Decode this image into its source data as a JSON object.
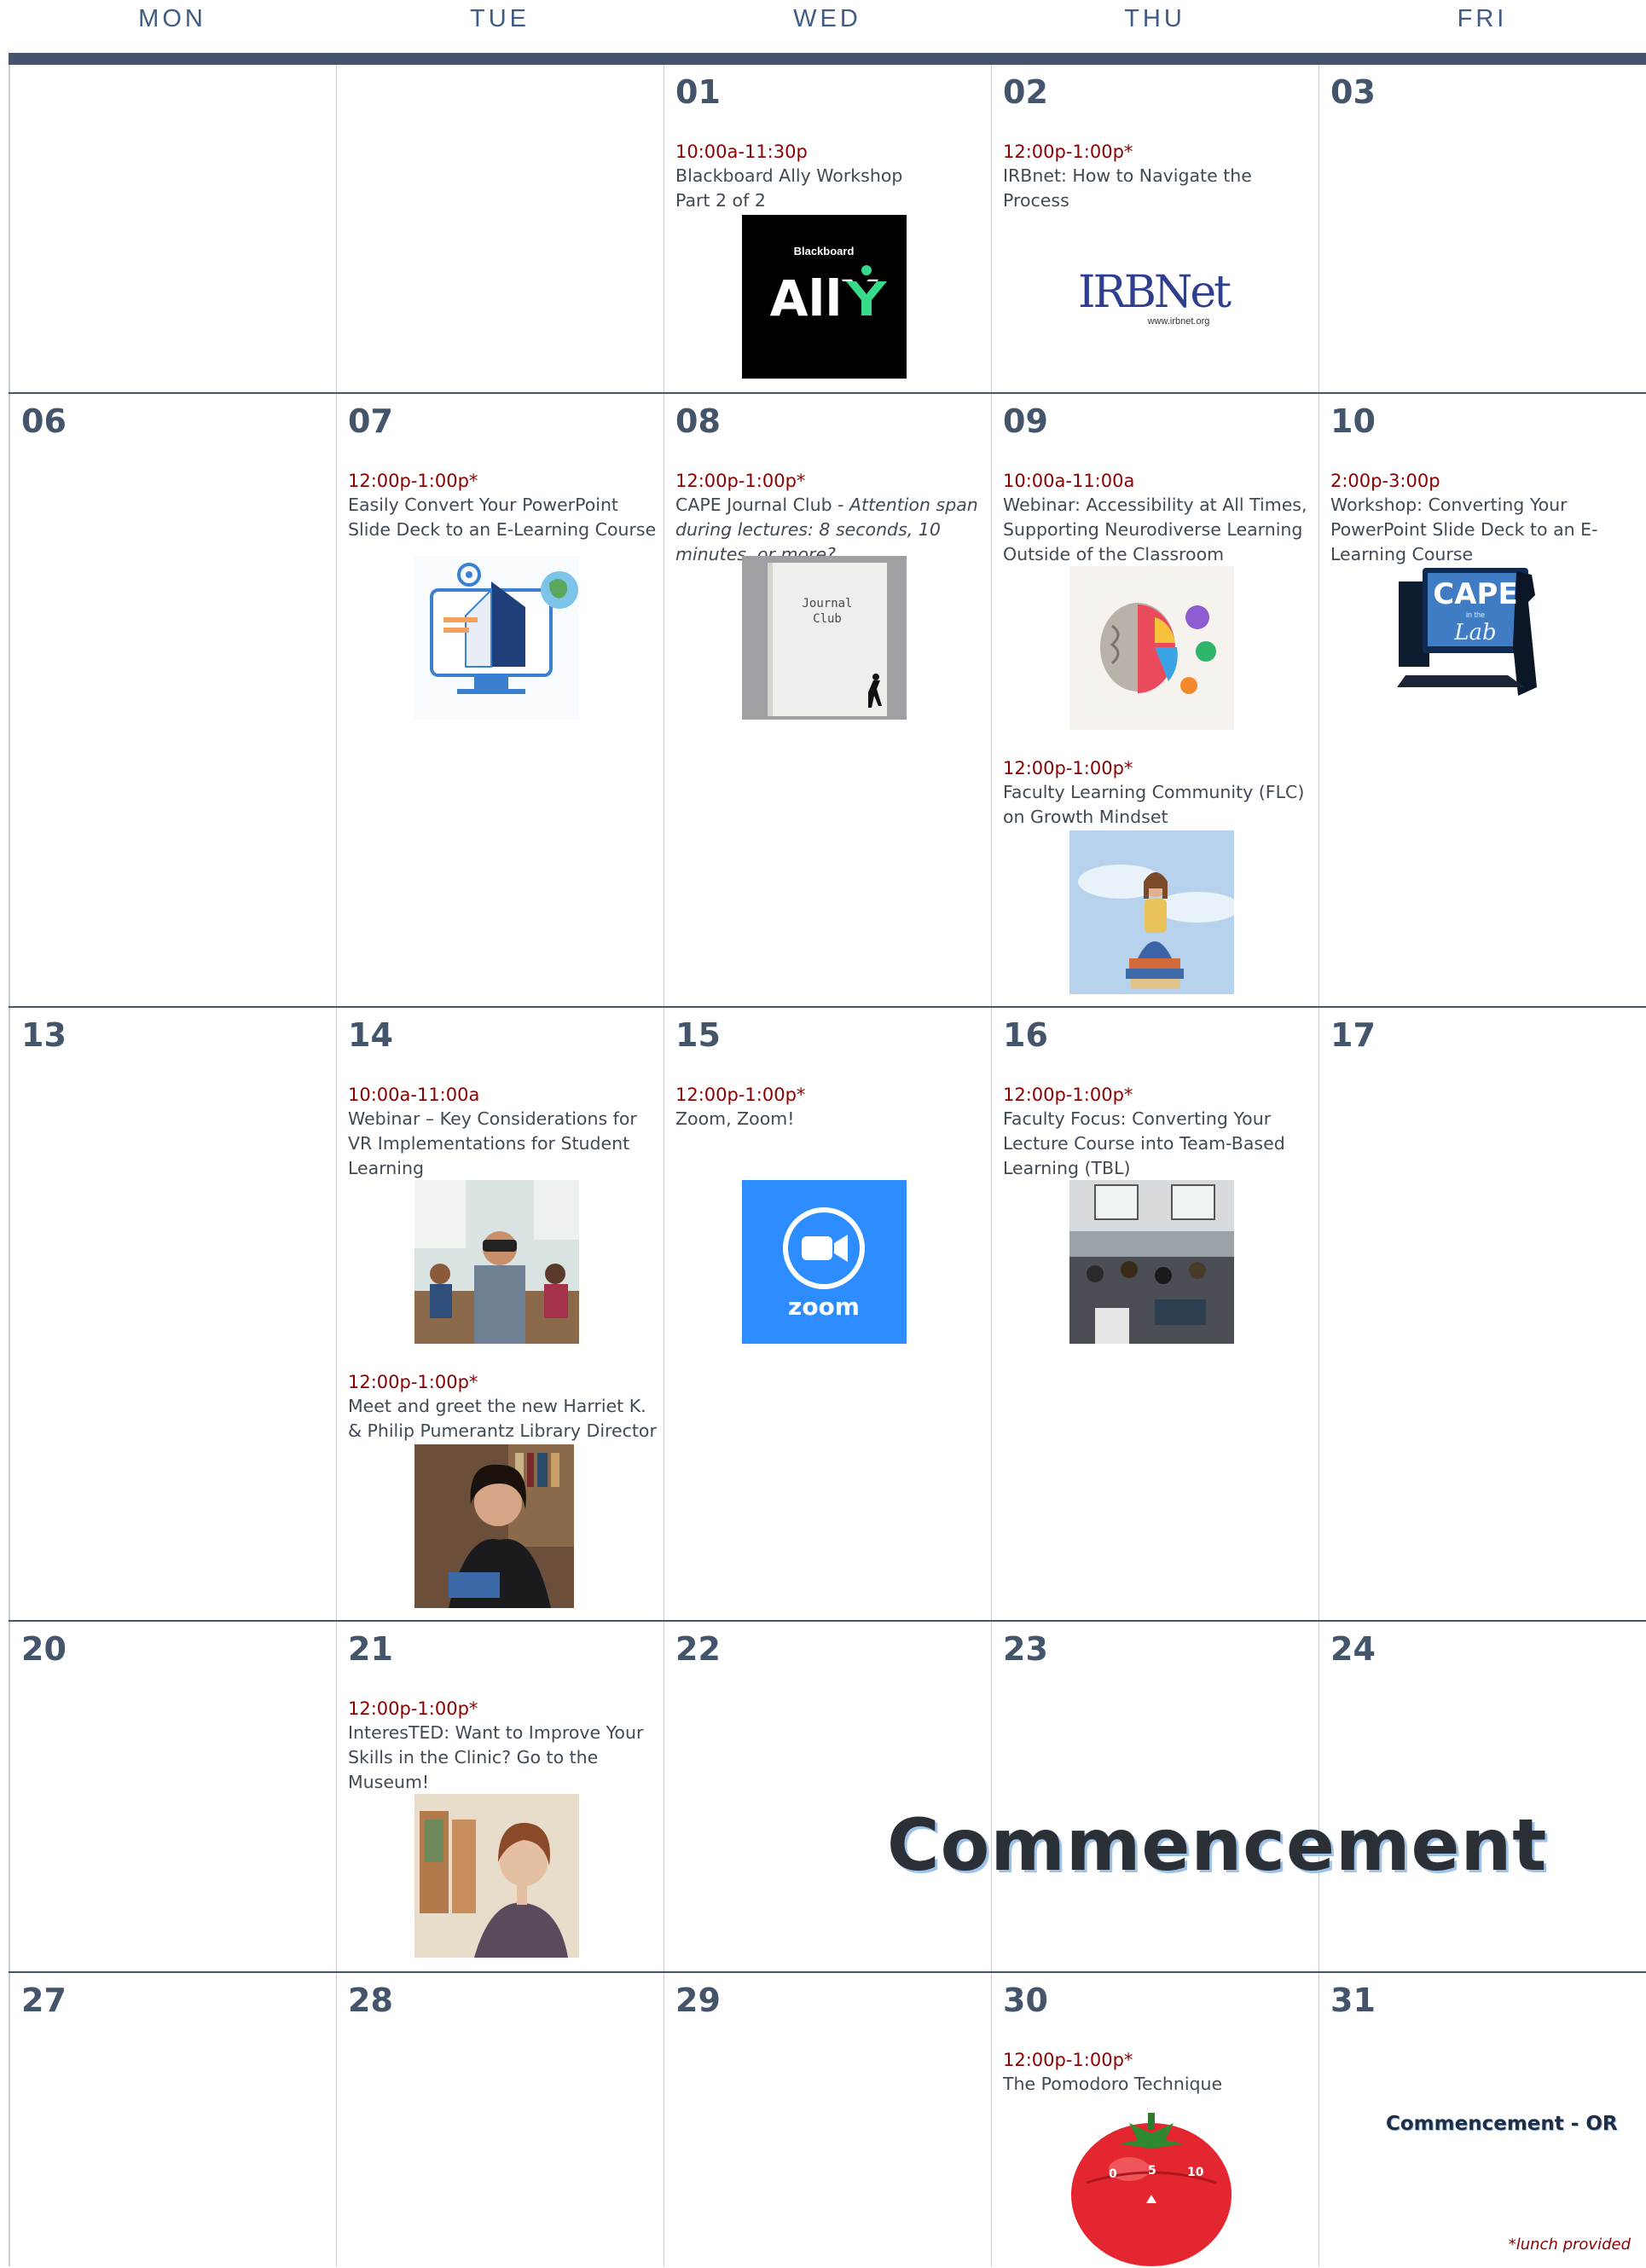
{
  "days": [
    "MON",
    "TUE",
    "WED",
    "THU",
    "FRI"
  ],
  "weeks": [
    {
      "dates": [
        "",
        "",
        "01",
        "02",
        "03"
      ]
    },
    {
      "dates": [
        "06",
        "07",
        "08",
        "09",
        "10"
      ]
    },
    {
      "dates": [
        "13",
        "14",
        "15",
        "16",
        "17"
      ]
    },
    {
      "dates": [
        "20",
        "21",
        "22",
        "23",
        "24"
      ]
    },
    {
      "dates": [
        "27",
        "28",
        "29",
        "30",
        "31"
      ]
    }
  ],
  "events": {
    "d01": {
      "time": "10:00a-11:30p",
      "title_line1": "Blackboard Ally Workshop",
      "title_line2": "Part 2 of 2"
    },
    "d02": {
      "time": "12:00p-1:00p*",
      "title_line1": "IRBnet: How to Navigate the",
      "title_line2": "Process"
    },
    "d07": {
      "time": "12:00p-1:00p*",
      "title_line1": "Easily Convert Your PowerPoint",
      "title_line2": "Slide Deck to an E-Learning Course"
    },
    "d08": {
      "time": "12:00p-1:00p*",
      "title_prefix": "CAPE Journal Club - ",
      "title_italic1": "Attention span",
      "title_italic2": "during lectures: 8 seconds, 10",
      "title_italic3": "minutes, or more?"
    },
    "d09a": {
      "time": "10:00a-11:00a",
      "title_line1": "Webinar: Accessibility at All Times,",
      "title_line2": "Supporting Neurodiverse Learning",
      "title_line3": "Outside of the Classroom"
    },
    "d09b": {
      "time": "12:00p-1:00p*",
      "title_line1": "Faculty Learning Community (FLC)",
      "title_line2": "on Growth Mindset"
    },
    "d10": {
      "time": "2:00p-3:00p",
      "title_line1": "Workshop: Converting Your",
      "title_line2": "PowerPoint Slide Deck to an E-",
      "title_line3": "Learning Course"
    },
    "d14a": {
      "time": "10:00a-11:00a",
      "title_line1": "Webinar – Key Considerations for",
      "title_line2": "VR Implementations for Student",
      "title_line3": "Learning"
    },
    "d14b": {
      "time": "12:00p-1:00p*",
      "title_line1": "Meet and greet the new Harriet K.",
      "title_line2": "& Philip Pumerantz Library Director"
    },
    "d15": {
      "time": "12:00p-1:00p*",
      "title_line1": "Zoom, Zoom!"
    },
    "d16": {
      "time": "12:00p-1:00p*",
      "title_line1": "Faculty Focus: Converting Your",
      "title_line2": "Lecture Course into Team-Based",
      "title_line3": "Learning (TBL)"
    },
    "d21": {
      "time": "12:00p-1:00p*",
      "title_line1": "InteresTED: Want to Improve Your",
      "title_line2": "Skills in the Clinic? Go to the",
      "title_line3": "Museum!"
    },
    "d30": {
      "time": "12:00p-1:00p*",
      "title_line1": "The Pomodoro Technique"
    }
  },
  "logos": {
    "ally_brand": "Blackboard",
    "ally_word": "AllY",
    "irbnet_word": "IRBNet",
    "irbnet_url": "www.irbnet.org",
    "journal_club": "Journal Club",
    "zoom_word": "zoom",
    "cape_word": "CAPE",
    "cape_small": "in the",
    "cape_lab": "Lab"
  },
  "commencement": "Commencement",
  "commencement_or": "Commencement - OR",
  "lunch_note": "*lunch provided",
  "colors": {
    "header_bar": "#44546a",
    "day_name": "#3f5b86",
    "time_red": "#8b0000",
    "zoom_blue": "#2d8cff"
  }
}
